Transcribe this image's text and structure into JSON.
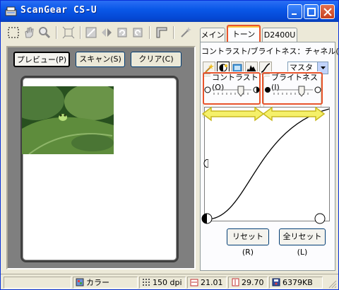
{
  "window": {
    "title": "ScanGear CS-U"
  },
  "preview": {
    "buttons": [
      "プレビュー(P)",
      "スキャン(S)",
      "クリア(C)"
    ]
  },
  "tabs": [
    "メイン",
    "トーン",
    "D2400U"
  ],
  "tone": {
    "heading": "コントラスト/ブライトネス：チャネル(A)：",
    "channel": "マスタ",
    "contrast_label": "コントラスト(O)",
    "brightness_label": "ブライトネス(I)",
    "reset_label": "リセット(R)",
    "reset_all_label": "全リセット(L)"
  },
  "status": {
    "color_mode": "カラー",
    "resolution": "150 dpi",
    "width": "21.01",
    "height": "29.70",
    "filesize": "6379KB"
  },
  "colors": {
    "title_bar": "#0a58e8",
    "highlight": "#e8542c",
    "arrow": "#f5f06a"
  }
}
